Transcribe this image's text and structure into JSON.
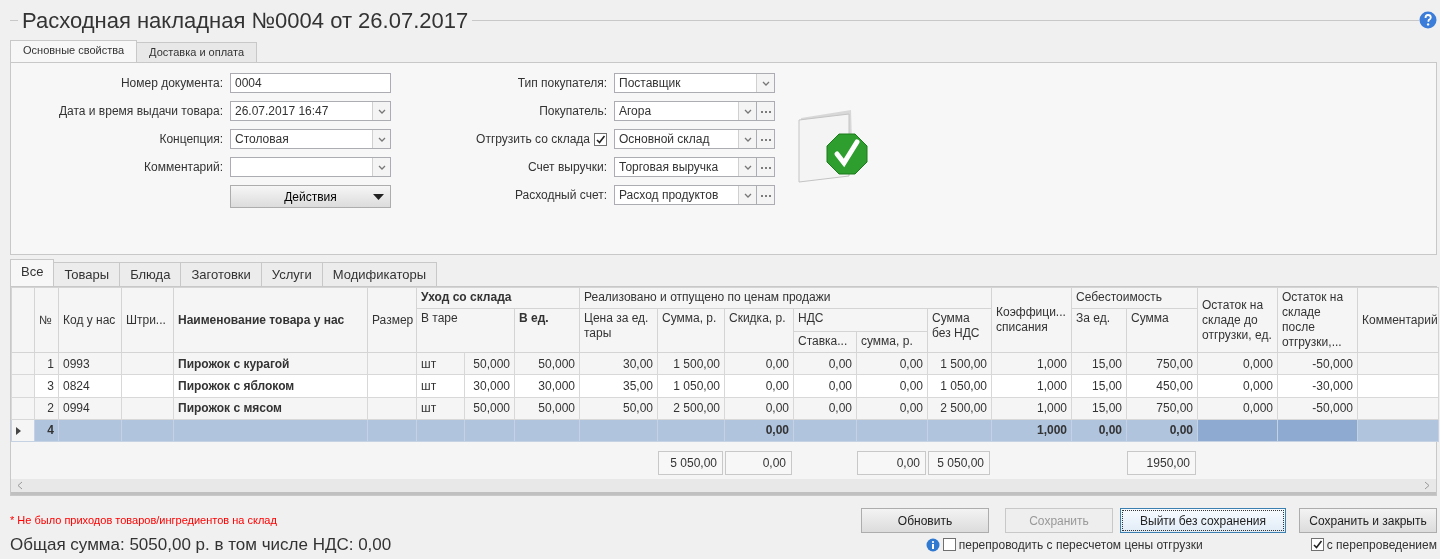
{
  "title": "Расходная накладная №0004 от 26.07.2017",
  "tabs": [
    {
      "label": "Основные свойства",
      "selected": true
    },
    {
      "label": "Доставка и оплата",
      "selected": false
    }
  ],
  "form_left": [
    {
      "kind": "text",
      "label": "Номер документа:",
      "value": "0004"
    },
    {
      "kind": "select",
      "label": "Дата и время выдачи товара:",
      "value": "26.07.2017 16:47"
    },
    {
      "kind": "select",
      "label": "Концепция:",
      "value": "Столовая"
    },
    {
      "kind": "select",
      "label": "Комментарий:"
    },
    {
      "kind": "menu-button",
      "value": "Действия"
    }
  ],
  "form_right": [
    {
      "kind": "select",
      "label": "Тип покупателя:",
      "value": "Поставщик"
    },
    {
      "kind": "select-browse",
      "label": "Покупатель:",
      "value": "Агора"
    },
    {
      "kind": "check-select-browse",
      "label": "Отгрузить со склада",
      "checked": true,
      "value": "Основной склад"
    },
    {
      "kind": "select-browse",
      "label": "Счет выручки:",
      "value": "Торговая выручка"
    },
    {
      "kind": "select-browse",
      "label": "Расходный счет:",
      "value": "Расход продуктов"
    }
  ],
  "grid_tabs": [
    {
      "label": "Все",
      "selected": true
    },
    {
      "label": "Товары",
      "selected": false
    },
    {
      "label": "Блюда",
      "selected": false
    },
    {
      "label": "Заготовки",
      "selected": false
    },
    {
      "label": "Услуги",
      "selected": false
    },
    {
      "label": "Модификаторы",
      "selected": false
    }
  ],
  "table": {
    "header_rows": [
      [
        {
          "label": "№",
          "bold": false
        },
        {
          "label": "Код у нас",
          "bold": false
        },
        {
          "label": "Штри...",
          "bold": false
        },
        {
          "label": "Наименование товара у нас",
          "bold": true
        },
        {
          "label": "Размер",
          "bold": false
        },
        {
          "label": "Уход со склада",
          "bold": true
        },
        {
          "label": "Реализовано и отпущено по ценам продажи",
          "bold": false
        },
        {
          "label": "Коэффици... списания",
          "bold": false
        },
        {
          "label": "Себестоимость",
          "bold": false
        },
        {
          "label": "Остаток на складе до отгрузки, ед.",
          "bold": false
        },
        {
          "label": "Остаток на складе после отгрузки,...",
          "bold": false
        },
        {
          "label": "Комментарий",
          "bold": false
        }
      ],
      [
        {
          "label": "В таре",
          "bold": false
        },
        {
          "label": "В ед.",
          "bold": true
        },
        {
          "label": "Цена за ед. тары",
          "bold": false
        },
        {
          "label": "Сумма, р.",
          "bold": false
        },
        {
          "label": "Скидка, р.",
          "bold": false
        },
        {
          "label": "НДС",
          "bold": false
        },
        {
          "label": "Сумма без НДС",
          "bold": false
        },
        {
          "label": "За ед.",
          "bold": false
        },
        {
          "label": "Сумма",
          "bold": false
        }
      ],
      [
        {
          "label": "Ставка...",
          "bold": false
        },
        {
          "label": "сумма, р.",
          "bold": false
        }
      ]
    ],
    "rows": [
      {
        "selected": false,
        "no": "1",
        "code": "0993",
        "name": "Пирожок с курагой",
        "unit": "шт",
        "qty_pack": "50,000",
        "qty_unit": "50,000",
        "price": "30,00",
        "sum": "1 500,00",
        "discount": "0,00",
        "vat_rate": "0,00",
        "vat_sum": "0,00",
        "sum_no_vat": "1 500,00",
        "coef": "1,000",
        "cost_unit": "15,00",
        "cost_sum": "750,00",
        "stock_before": "0,000",
        "stock_after": "-50,000"
      },
      {
        "selected": false,
        "no": "3",
        "code": "0824",
        "name": "Пирожок с яблоком",
        "unit": "шт",
        "qty_pack": "30,000",
        "qty_unit": "30,000",
        "price": "35,00",
        "sum": "1 050,00",
        "discount": "0,00",
        "vat_rate": "0,00",
        "vat_sum": "0,00",
        "sum_no_vat": "1 050,00",
        "coef": "1,000",
        "cost_unit": "15,00",
        "cost_sum": "450,00",
        "stock_before": "0,000",
        "stock_after": "-30,000"
      },
      {
        "selected": false,
        "no": "2",
        "code": "0994",
        "name": "Пирожок с мясом",
        "unit": "шт",
        "qty_pack": "50,000",
        "qty_unit": "50,000",
        "price": "50,00",
        "sum": "2 500,00",
        "discount": "0,00",
        "vat_rate": "0,00",
        "vat_sum": "0,00",
        "sum_no_vat": "2 500,00",
        "coef": "1,000",
        "cost_unit": "15,00",
        "cost_sum": "750,00",
        "stock_before": "0,000",
        "stock_after": "-50,000"
      },
      {
        "selected": true,
        "no": "4",
        "discount": "0,00",
        "coef": "1,000",
        "cost_unit": "0,00",
        "cost_sum": "0,00"
      }
    ],
    "totals": {
      "sum": "5 050,00",
      "discount": "0,00",
      "vat_sum": "0,00",
      "sum_no_vat": "5 050,00",
      "cost_sum": "1950,00"
    }
  },
  "warning": "* Не было приходов товаров/ингредиентов на склад",
  "total_line": "Общая сумма: 5050,00 р. в том числе НДС: 0,00",
  "buttons": [
    {
      "label": "Обновить",
      "disabled": false,
      "focused": false
    },
    {
      "label": "Сохранить",
      "disabled": true,
      "focused": false
    },
    {
      "label": "Выйти без сохранения",
      "disabled": false,
      "focused": true
    },
    {
      "label": "Сохранить и закрыть",
      "disabled": false,
      "focused": false
    }
  ],
  "options": [
    {
      "label": "перепроводить с пересчетом цены отгрузки",
      "checked": false,
      "info": true
    },
    {
      "label": "с перепроведением",
      "checked": true,
      "info": false
    }
  ]
}
